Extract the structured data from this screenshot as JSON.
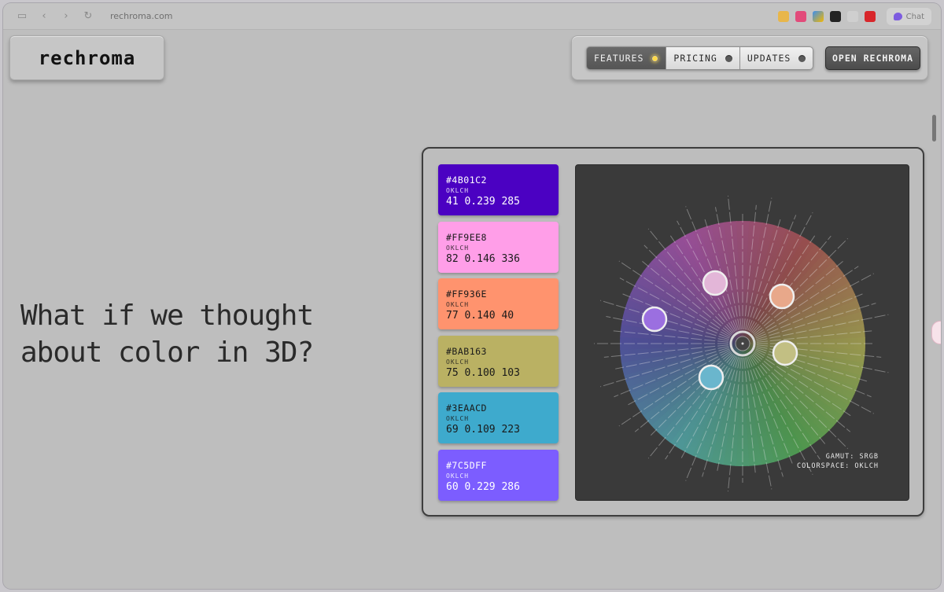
{
  "browser": {
    "url": "rechroma.com",
    "chat_label": "Chat"
  },
  "header": {
    "logo": "rechroma",
    "nav": [
      {
        "label": "FEATURES",
        "active": true
      },
      {
        "label": "PRICING",
        "active": false
      },
      {
        "label": "UPDATES",
        "active": false
      }
    ],
    "cta": "OPEN RECHROMA"
  },
  "hero": {
    "line1": "What if we thought",
    "line2": "about color in 3D?"
  },
  "palette": [
    {
      "hex": "#4B01C2",
      "space": "OKLCH",
      "values": "41 0.239 285",
      "bg": "#4b01c2",
      "text": "#ffffff"
    },
    {
      "hex": "#FF9EE8",
      "space": "OKLCH",
      "values": "82 0.146 336",
      "bg": "#ff9ee8",
      "text": "#1a1a1a"
    },
    {
      "hex": "#FF936E",
      "space": "OKLCH",
      "values": "77 0.140 40",
      "bg": "#ff936e",
      "text": "#1a1a1a"
    },
    {
      "hex": "#BAB163",
      "space": "OKLCH",
      "values": "75 0.100 103",
      "bg": "#bab163",
      "text": "#1a1a1a"
    },
    {
      "hex": "#3EAACD",
      "space": "OKLCH",
      "values": "69 0.109 223",
      "bg": "#3eaacd",
      "text": "#1a1a1a"
    },
    {
      "hex": "#7C5DFF",
      "space": "OKLCH",
      "values": "60 0.229 286",
      "bg": "#7c5dff",
      "text": "#ffffff"
    }
  ],
  "viewer": {
    "gamut": "GAMUT: SRGB",
    "colorspace": "COLORSPACE: OKLCH",
    "handles": [
      "#e3b6d8",
      "#e8a88a",
      "#9b6fe0",
      "#c2bf83",
      "#6ab6cd"
    ]
  },
  "colors": {
    "page_bg": "#bebebe",
    "viewer_bg": "#3a3a3a",
    "accent_led": "#ffd94a"
  }
}
